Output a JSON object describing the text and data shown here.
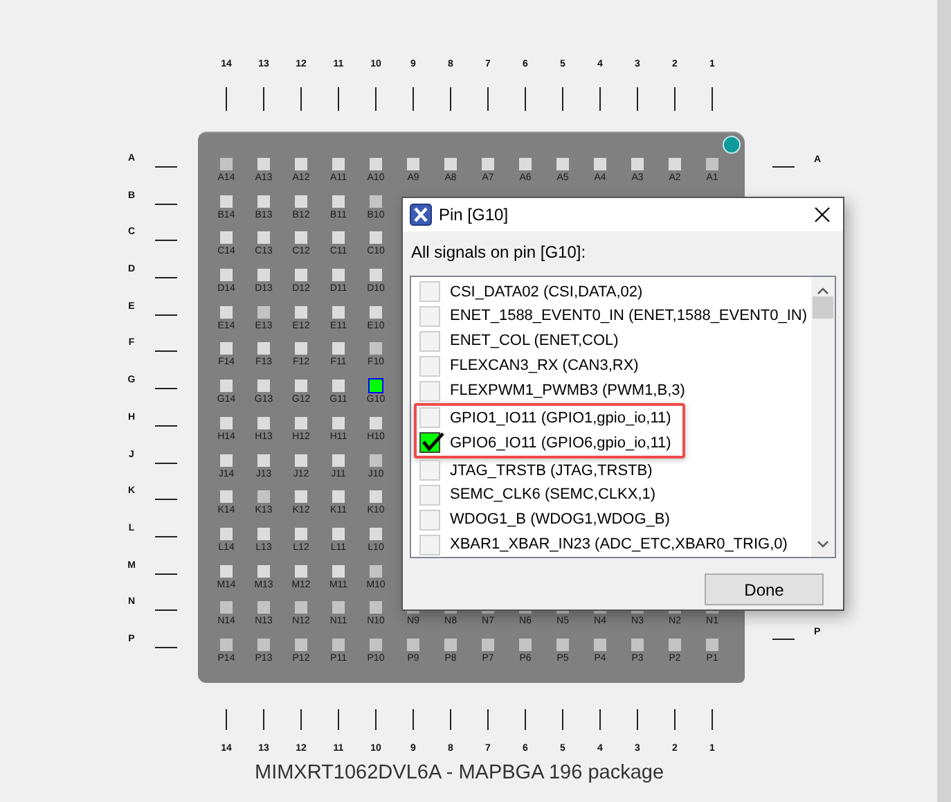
{
  "package": {
    "top_column_labels": [
      "14",
      "13",
      "12",
      "11",
      "10",
      "9",
      "8",
      "7",
      "6",
      "5",
      "4",
      "3",
      "2",
      "1"
    ],
    "left_row_labels": [
      "A",
      "B",
      "C",
      "D",
      "E",
      "F",
      "G",
      "H",
      "J",
      "K",
      "L",
      "M",
      "N",
      "P"
    ],
    "right_row_labels": {
      "top": "A",
      "bottom": "P"
    },
    "pin_rows": [
      {
        "pins": [
          {
            "label": "A14",
            "assigned": true,
            "selected": false
          },
          {
            "label": "A13",
            "assigned": false,
            "selected": false
          },
          {
            "label": "A12",
            "assigned": false,
            "selected": false
          },
          {
            "label": "A11",
            "assigned": false,
            "selected": false
          },
          {
            "label": "A10",
            "assigned": false,
            "selected": false
          },
          {
            "label": "A9",
            "assigned": false,
            "selected": false
          },
          {
            "label": "A8",
            "assigned": false,
            "selected": false
          },
          {
            "label": "A7",
            "assigned": false,
            "selected": false
          },
          {
            "label": "A6",
            "assigned": false,
            "selected": false
          },
          {
            "label": "A5",
            "assigned": false,
            "selected": false
          },
          {
            "label": "A4",
            "assigned": false,
            "selected": false
          },
          {
            "label": "A3",
            "assigned": false,
            "selected": false
          },
          {
            "label": "A2",
            "assigned": false,
            "selected": false
          },
          {
            "label": "A1",
            "assigned": true,
            "selected": false
          }
        ]
      },
      {
        "pins": [
          {
            "label": "B14",
            "assigned": false,
            "selected": false
          },
          {
            "label": "B13",
            "assigned": false,
            "selected": false
          },
          {
            "label": "B12",
            "assigned": false,
            "selected": false
          },
          {
            "label": "B11",
            "assigned": false,
            "selected": false
          },
          {
            "label": "B10",
            "assigned": true,
            "selected": false
          }
        ]
      },
      {
        "pins": [
          {
            "label": "C14",
            "assigned": false,
            "selected": false
          },
          {
            "label": "C13",
            "assigned": false,
            "selected": false
          },
          {
            "label": "C12",
            "assigned": false,
            "selected": false
          },
          {
            "label": "C11",
            "assigned": false,
            "selected": false
          },
          {
            "label": "C10",
            "assigned": false,
            "selected": false
          }
        ]
      },
      {
        "pins": [
          {
            "label": "D14",
            "assigned": false,
            "selected": false
          },
          {
            "label": "D13",
            "assigned": false,
            "selected": false
          },
          {
            "label": "D12",
            "assigned": false,
            "selected": false
          },
          {
            "label": "D11",
            "assigned": false,
            "selected": false
          },
          {
            "label": "D10",
            "assigned": false,
            "selected": false
          }
        ]
      },
      {
        "pins": [
          {
            "label": "E14",
            "assigned": false,
            "selected": false
          },
          {
            "label": "E13",
            "assigned": true,
            "selected": false
          },
          {
            "label": "E12",
            "assigned": false,
            "selected": false
          },
          {
            "label": "E11",
            "assigned": false,
            "selected": false
          },
          {
            "label": "E10",
            "assigned": false,
            "selected": false
          }
        ]
      },
      {
        "pins": [
          {
            "label": "F14",
            "assigned": false,
            "selected": false
          },
          {
            "label": "F13",
            "assigned": false,
            "selected": false
          },
          {
            "label": "F12",
            "assigned": false,
            "selected": false
          },
          {
            "label": "F11",
            "assigned": false,
            "selected": false
          },
          {
            "label": "F10",
            "assigned": true,
            "selected": false
          }
        ]
      },
      {
        "pins": [
          {
            "label": "G14",
            "assigned": false,
            "selected": false
          },
          {
            "label": "G13",
            "assigned": false,
            "selected": false
          },
          {
            "label": "G12",
            "assigned": false,
            "selected": false
          },
          {
            "label": "G11",
            "assigned": false,
            "selected": false
          },
          {
            "label": "G10",
            "assigned": false,
            "selected": true
          }
        ]
      },
      {
        "pins": [
          {
            "label": "H14",
            "assigned": false,
            "selected": false
          },
          {
            "label": "H13",
            "assigned": false,
            "selected": false
          },
          {
            "label": "H12",
            "assigned": false,
            "selected": false
          },
          {
            "label": "H11",
            "assigned": false,
            "selected": false
          },
          {
            "label": "H10",
            "assigned": false,
            "selected": false
          }
        ]
      },
      {
        "pins": [
          {
            "label": "J14",
            "assigned": false,
            "selected": false
          },
          {
            "label": "J13",
            "assigned": false,
            "selected": false
          },
          {
            "label": "J12",
            "assigned": false,
            "selected": false
          },
          {
            "label": "J11",
            "assigned": false,
            "selected": false
          },
          {
            "label": "J10",
            "assigned": true,
            "selected": false
          }
        ]
      },
      {
        "pins": [
          {
            "label": "K14",
            "assigned": false,
            "selected": false
          },
          {
            "label": "K13",
            "assigned": true,
            "selected": false
          },
          {
            "label": "K12",
            "assigned": false,
            "selected": false
          },
          {
            "label": "K11",
            "assigned": false,
            "selected": false
          },
          {
            "label": "K10",
            "assigned": false,
            "selected": false
          }
        ]
      },
      {
        "pins": [
          {
            "label": "L14",
            "assigned": false,
            "selected": false
          },
          {
            "label": "L13",
            "assigned": false,
            "selected": false
          },
          {
            "label": "L12",
            "assigned": false,
            "selected": false
          },
          {
            "label": "L11",
            "assigned": false,
            "selected": false
          },
          {
            "label": "L10",
            "assigned": false,
            "selected": false
          }
        ]
      },
      {
        "pins": [
          {
            "label": "M14",
            "assigned": false,
            "selected": false
          },
          {
            "label": "M13",
            "assigned": false,
            "selected": false
          },
          {
            "label": "M12",
            "assigned": false,
            "selected": false
          },
          {
            "label": "M11",
            "assigned": false,
            "selected": false
          },
          {
            "label": "M10",
            "assigned": true,
            "selected": false
          }
        ]
      },
      {
        "pins": [
          {
            "label": "N14",
            "assigned": true,
            "selected": false
          },
          {
            "label": "N13",
            "assigned": true,
            "selected": false
          },
          {
            "label": "N12",
            "assigned": true,
            "selected": false
          },
          {
            "label": "N11",
            "assigned": true,
            "selected": false
          },
          {
            "label": "N10",
            "assigned": true,
            "selected": false
          },
          {
            "label": "N9",
            "assigned": true,
            "selected": false
          },
          {
            "label": "N8",
            "assigned": true,
            "selected": false
          },
          {
            "label": "N7",
            "assigned": true,
            "selected": false
          },
          {
            "label": "N6",
            "assigned": true,
            "selected": false
          },
          {
            "label": "N5",
            "assigned": true,
            "selected": false
          },
          {
            "label": "N4",
            "assigned": true,
            "selected": false
          },
          {
            "label": "N3",
            "assigned": true,
            "selected": false
          },
          {
            "label": "N2",
            "assigned": true,
            "selected": false
          },
          {
            "label": "N1",
            "assigned": true,
            "selected": false
          }
        ]
      },
      {
        "pins": [
          {
            "label": "P14",
            "assigned": true,
            "selected": false
          },
          {
            "label": "P13",
            "assigned": true,
            "selected": false
          },
          {
            "label": "P12",
            "assigned": true,
            "selected": false
          },
          {
            "label": "P11",
            "assigned": true,
            "selected": false
          },
          {
            "label": "P10",
            "assigned": true,
            "selected": false
          },
          {
            "label": "P9",
            "assigned": true,
            "selected": false
          },
          {
            "label": "P8",
            "assigned": true,
            "selected": false
          },
          {
            "label": "P7",
            "assigned": true,
            "selected": false
          },
          {
            "label": "P6",
            "assigned": true,
            "selected": false
          },
          {
            "label": "P5",
            "assigned": true,
            "selected": false
          },
          {
            "label": "P4",
            "assigned": true,
            "selected": false
          },
          {
            "label": "P3",
            "assigned": true,
            "selected": false
          },
          {
            "label": "P2",
            "assigned": true,
            "selected": false
          },
          {
            "label": "P1",
            "assigned": true,
            "selected": false
          }
        ]
      }
    ],
    "bottom_column_labels": [
      "14",
      "13",
      "12",
      "11",
      "10",
      "9",
      "8",
      "7",
      "6",
      "5",
      "4",
      "3",
      "2",
      "1"
    ],
    "caption": "MIMXRT1062DVL6A - MAPBGA 196 package"
  },
  "dialog": {
    "title": "Pin [G10]",
    "prompt": "All signals on pin [G10]:",
    "signals": [
      {
        "label": "CSI_DATA02 (CSI,DATA,02)",
        "checked": false,
        "highlighted": false
      },
      {
        "label": "ENET_1588_EVENT0_IN (ENET,1588_EVENT0_IN)",
        "checked": false,
        "highlighted": false
      },
      {
        "label": "ENET_COL (ENET,COL)",
        "checked": false,
        "highlighted": false
      },
      {
        "label": "FLEXCAN3_RX (CAN3,RX)",
        "checked": false,
        "highlighted": false
      },
      {
        "label": "FLEXPWM1_PWMB3 (PWM1,B,3)",
        "checked": false,
        "highlighted": false
      },
      {
        "label": "GPIO1_IO11 (GPIO1,gpio_io,11)",
        "checked": false,
        "highlighted": true
      },
      {
        "label": "GPIO6_IO11 (GPIO6,gpio_io,11)",
        "checked": true,
        "highlighted": true
      },
      {
        "label": "JTAG_TRSTB (JTAG,TRSTB)",
        "checked": false,
        "highlighted": false
      },
      {
        "label": "SEMC_CLK6 (SEMC,CLKX,1)",
        "checked": false,
        "highlighted": false
      },
      {
        "label": "WDOG1_B (WDOG1,WDOG_B)",
        "checked": false,
        "highlighted": false
      },
      {
        "label": "XBAR1_XBAR_IN23 (ADC_ETC,XBAR0_TRIG,0)",
        "checked": false,
        "highlighted": false
      }
    ],
    "button": "Done"
  }
}
